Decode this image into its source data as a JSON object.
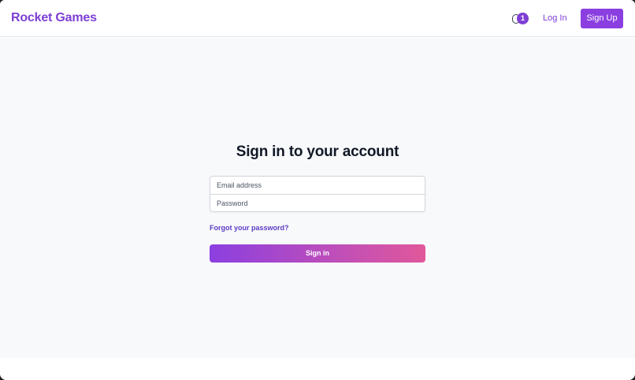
{
  "header": {
    "brand": "Rocket Games",
    "cart_count": "1",
    "login_label": "Log In",
    "signup_label": "Sign Up"
  },
  "main": {
    "title": "Sign in to your account",
    "email_placeholder": "Email address",
    "password_placeholder": "Password",
    "forgot_label": "Forgot your password?",
    "signin_label": "Sign in"
  },
  "colors": {
    "brand": "#7e3fd4",
    "badge": "#7e3fd4",
    "button_gradient_start": "#8b3fe0",
    "button_gradient_end": "#e0589a",
    "link": "#5b3cc4",
    "page_background": "#f8f9fb"
  },
  "icons": {
    "cart": "cart-icon"
  }
}
